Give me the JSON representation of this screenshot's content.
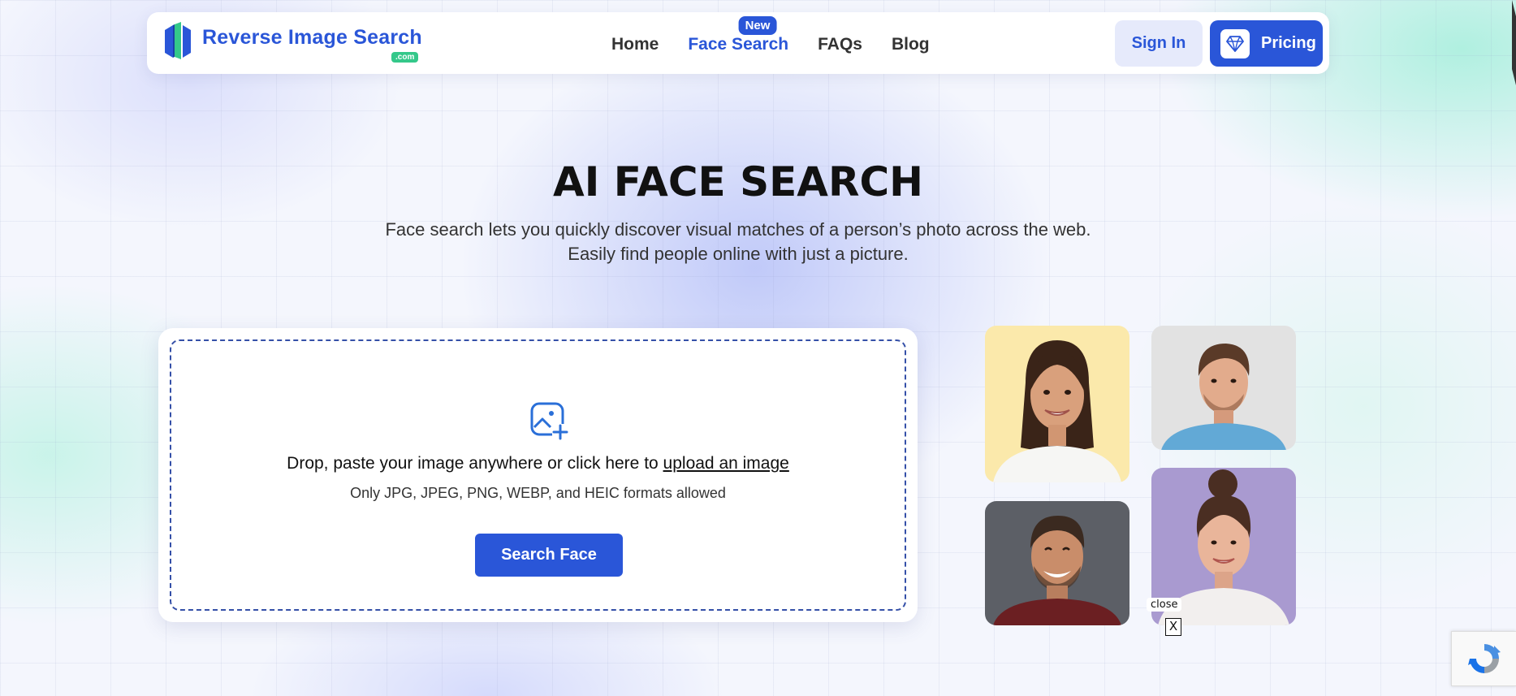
{
  "nav": {
    "logo_text": "Reverse Image Search",
    "logo_suffix": ".com",
    "links": [
      {
        "label": "Home",
        "active": false
      },
      {
        "label": "Face Search",
        "active": true
      },
      {
        "label": "FAQs",
        "active": false
      },
      {
        "label": "Blog",
        "active": false
      }
    ],
    "new_badge": "New",
    "signin_label": "Sign In",
    "pricing_label": "Pricing",
    "pricing_icon": "diamond-icon"
  },
  "hero": {
    "title": "AI FACE SEARCH",
    "subtitle_line1": "Face search lets you quickly discover visual matches of a person’s photo across the web.",
    "subtitle_line2": "Easily find people online with just a picture."
  },
  "upload": {
    "icon": "image-plus-icon",
    "drop_text": "Drop, paste your image anywhere or click here to ",
    "drop_link": "upload an image",
    "formats_text": "Only JPG, JPEG, PNG, WEBP, and HEIC formats allowed",
    "button_label": "Search Face"
  },
  "examples": [
    {
      "name": "example-face-woman-smiling"
    },
    {
      "name": "example-face-man-blue-shirt"
    },
    {
      "name": "example-face-man-laughing"
    },
    {
      "name": "example-face-woman-bun"
    }
  ],
  "overlay": {
    "close_label": "close",
    "close_x": "X"
  },
  "colors": {
    "brand": "#2a56d8",
    "logo_accent": "#34c88a"
  }
}
